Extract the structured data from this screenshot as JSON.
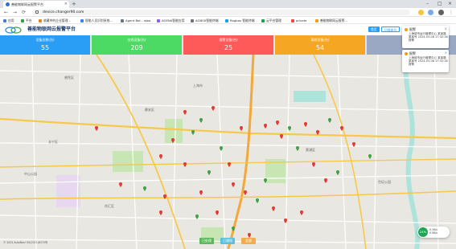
{
  "browser": {
    "tab_title": "善能物联网云报警平台",
    "tab_close": "×",
    "new_tab": "+",
    "url": "device.changer90.com",
    "window_controls": [
      "–",
      "□",
      "×"
    ],
    "nav": [
      "←",
      "→",
      "⟳"
    ]
  },
  "bookmarks": [
    {
      "label": "应用",
      "color": "#4a7bd0"
    },
    {
      "label": "平台",
      "color": "#2f9e44"
    },
    {
      "label": "收藏中的企业管理...",
      "color": "#e67e22"
    },
    {
      "label": "智能人员识别系统...",
      "color": "#3b82f6"
    },
    {
      "label": "Agent Bot - rqba",
      "color": "#6b7280"
    },
    {
      "label": "AGENA智能应用",
      "color": "#8b5cf6"
    },
    {
      "label": "AGBOX智能终端",
      "color": "#6b7280"
    },
    {
      "label": "Ragbox 智能终端",
      "color": "#0ea5e9"
    },
    {
      "label": "云平台管理",
      "color": "#16a34a"
    },
    {
      "label": "private",
      "color": "#ef4444"
    },
    {
      "label": "善能物联网云报警...",
      "color": "#f59e0b"
    }
  ],
  "app": {
    "title": "善能物联网云报警平台",
    "header_buttons": [
      "首页",
      "切换账号"
    ]
  },
  "stats": [
    {
      "label": "设备总数(台)",
      "value": "55",
      "color": "#2a9df4"
    },
    {
      "label": "在线设备(台)",
      "value": "209",
      "color": "#4cd964"
    },
    {
      "label": "报警设备(台)",
      "value": "25",
      "color": "#ff5a5a"
    },
    {
      "label": "离线设备(台)",
      "value": "54",
      "color": "#f5a623"
    },
    {
      "label": "",
      "value": "",
      "color": "#9aa8c4"
    }
  ],
  "popups": [
    {
      "title": "报警",
      "text": "上海城市运行管理中心 某某路某某号 2024-03-08 17:32:26 报警"
    },
    {
      "title": "报警",
      "text": "上海城市运行管理中心 某某路某某号 2024-03-08 17:32:26 报警"
    }
  ],
  "bottom_buttons": [
    {
      "label": "已处理",
      "color": "#5cb85c"
    },
    {
      "label": "已通知",
      "color": "#5bc0de"
    },
    {
      "label": "全部",
      "color": "#f0ad4e"
    }
  ],
  "widget": {
    "value": "24%",
    "line1": "0.1K/s",
    "line2": "0.5K/s"
  },
  "copyright": "© 2024 AutoNavi GS(2021)6375号",
  "map_labels": [
    "上海市",
    "静安区",
    "黄浦区",
    "徐汇区",
    "长宁区",
    "普陀区",
    "世纪公园",
    "中山公园"
  ],
  "marker_colors": {
    "alarm": "#e53935",
    "normal": "#43a047"
  },
  "icons": [
    "favicon-icon",
    "lock-icon",
    "logo-icon",
    "marker-icon"
  ]
}
